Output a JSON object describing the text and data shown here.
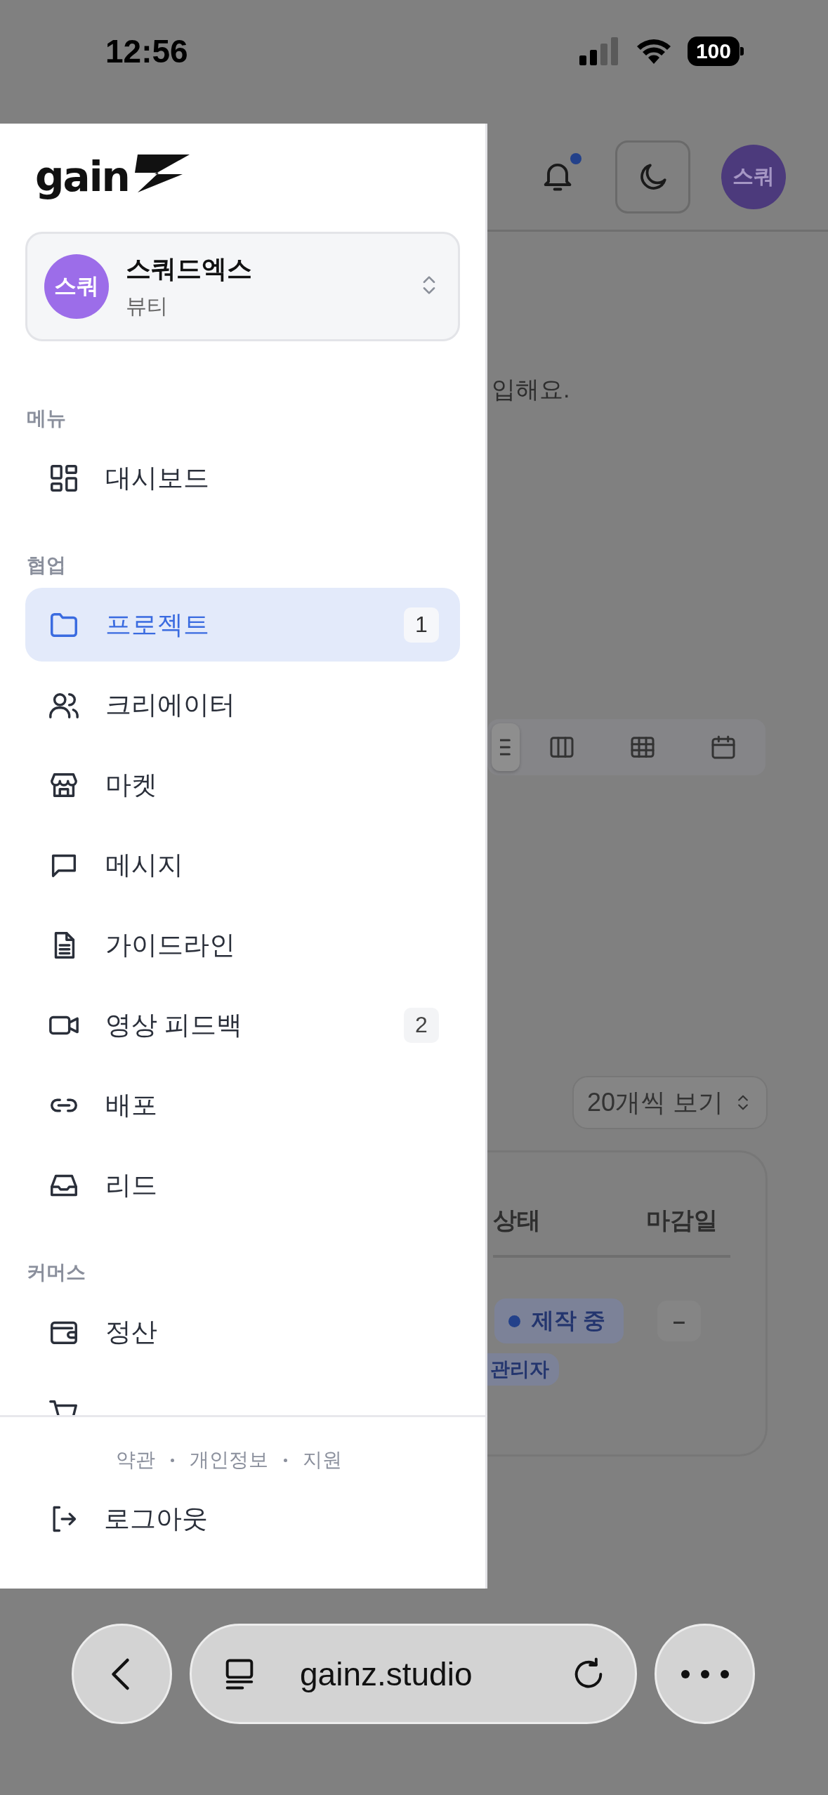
{
  "status_bar": {
    "time": "12:56",
    "battery": "100"
  },
  "header": {
    "notification_unread": true,
    "avatar": "스쿼"
  },
  "page": {
    "description": "입해요.",
    "view_options": [
      {
        "selected": true
      },
      {
        "selected": false
      },
      {
        "selected": false
      },
      {
        "selected": false
      }
    ],
    "page_size": "20개씩 보기",
    "table": {
      "columns": [
        "상태",
        "마감일"
      ],
      "rows": [
        {
          "status": "제작 중",
          "deadline": "–",
          "role": "관리자"
        }
      ]
    }
  },
  "sidebar": {
    "brand": "gain",
    "workspace": {
      "avatar": "스쿼",
      "name": "스쿼드엑스",
      "category": "뷰티"
    },
    "sections": [
      {
        "title": "메뉴",
        "items": [
          {
            "label": "대시보드",
            "selected": false
          }
        ]
      },
      {
        "title": "협업",
        "items": [
          {
            "label": "프로젝트",
            "selected": true,
            "badge": "1"
          },
          {
            "label": "크리에이터",
            "selected": false
          },
          {
            "label": "마켓",
            "selected": false
          },
          {
            "label": "메시지",
            "selected": false
          },
          {
            "label": "가이드라인",
            "selected": false
          },
          {
            "label": "영상 피드백",
            "selected": false,
            "badge": "2"
          },
          {
            "label": "배포",
            "selected": false
          },
          {
            "label": "리드",
            "selected": false
          }
        ]
      },
      {
        "title": "커머스",
        "items": [
          {
            "label": "정산",
            "selected": false
          },
          {
            "selected": false
          }
        ]
      }
    ],
    "footer_links": [
      "약관",
      "개인정보",
      "지원"
    ],
    "logout": "로그아웃"
  },
  "browser": {
    "url": "gainz.studio"
  }
}
